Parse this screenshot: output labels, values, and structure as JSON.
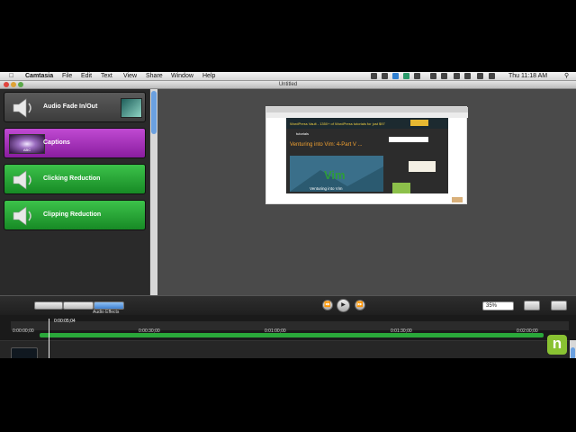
{
  "menubar": {
    "app_name": "Camtasia",
    "menus": [
      "File",
      "Edit",
      "Text",
      "View",
      "Share",
      "Window",
      "Help"
    ],
    "clock": "Thu 11:18 AM"
  },
  "window": {
    "title": "Untitled"
  },
  "effects": [
    {
      "label": "Audio Fade In/Out",
      "color": "gray"
    },
    {
      "label": "Captions",
      "color": "purple"
    },
    {
      "label": "Clicking Reduction",
      "color": "green"
    },
    {
      "label": "Clipping Reduction",
      "color": "green"
    }
  ],
  "toolbar": {
    "audio_effects_label": "Audio Effects",
    "zoom_value": "35%"
  },
  "timeline": {
    "playhead_time": "0:00:05;04",
    "ticks": [
      "0:00:00;00",
      "0:00:30;00",
      "0:01:00;00",
      "0:01:30;00",
      "0:02:00;00"
    ]
  },
  "preview": {
    "banner_text": "WordPress Vault - 1350+ of WordPress tutorials for just $97",
    "site_name": "tutorials",
    "article_title": "Venturing into Vim: 4-Part V ...",
    "video_caption": "Venturing into Vim",
    "logo_text": "Vim"
  },
  "branding": {
    "logo_letter": "n"
  }
}
